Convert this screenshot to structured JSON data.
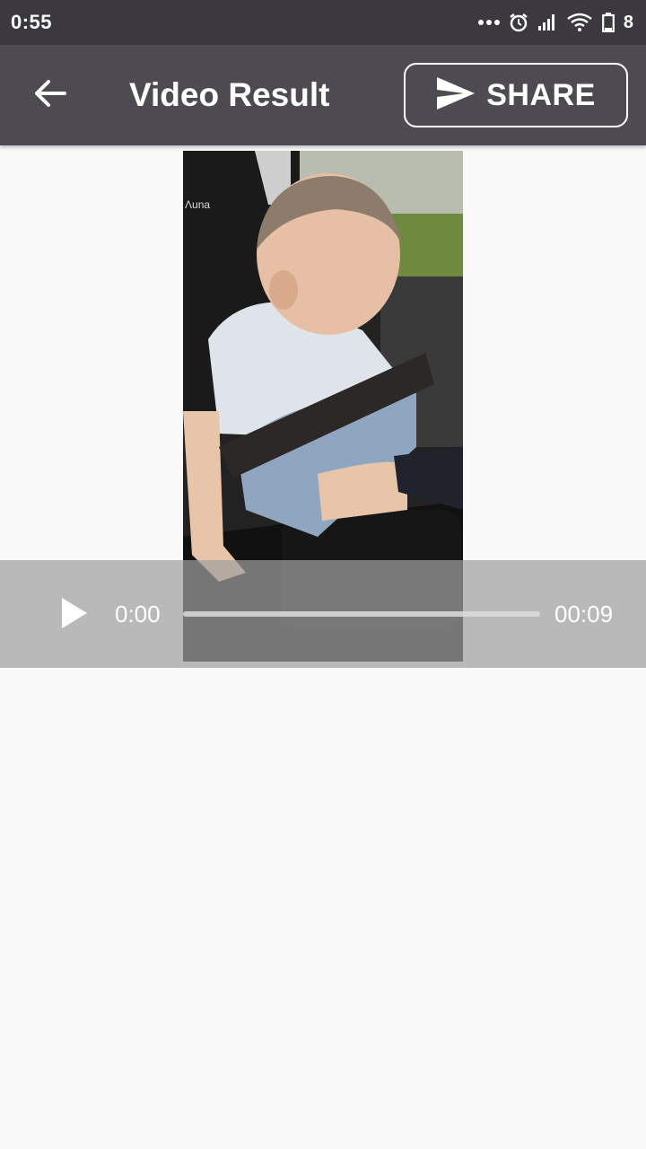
{
  "status_bar": {
    "time": "0:55",
    "battery_level": "8",
    "icons": [
      "more-dots-icon",
      "alarm-icon",
      "signal-icon",
      "wifi-icon",
      "battery-icon"
    ]
  },
  "app_bar": {
    "title": "Video Result",
    "back_icon": "arrow-left-icon",
    "share_label": "SHARE",
    "share_icon": "send-icon"
  },
  "player": {
    "current_time": "0:00",
    "total_time": "00:09",
    "progress": 0,
    "play_icon": "play-icon"
  },
  "colors": {
    "status_bar": "#3c3840",
    "app_bar": "#4e4a52",
    "background": "#f9f9f9",
    "controls_overlay": "#a0a0a0"
  }
}
